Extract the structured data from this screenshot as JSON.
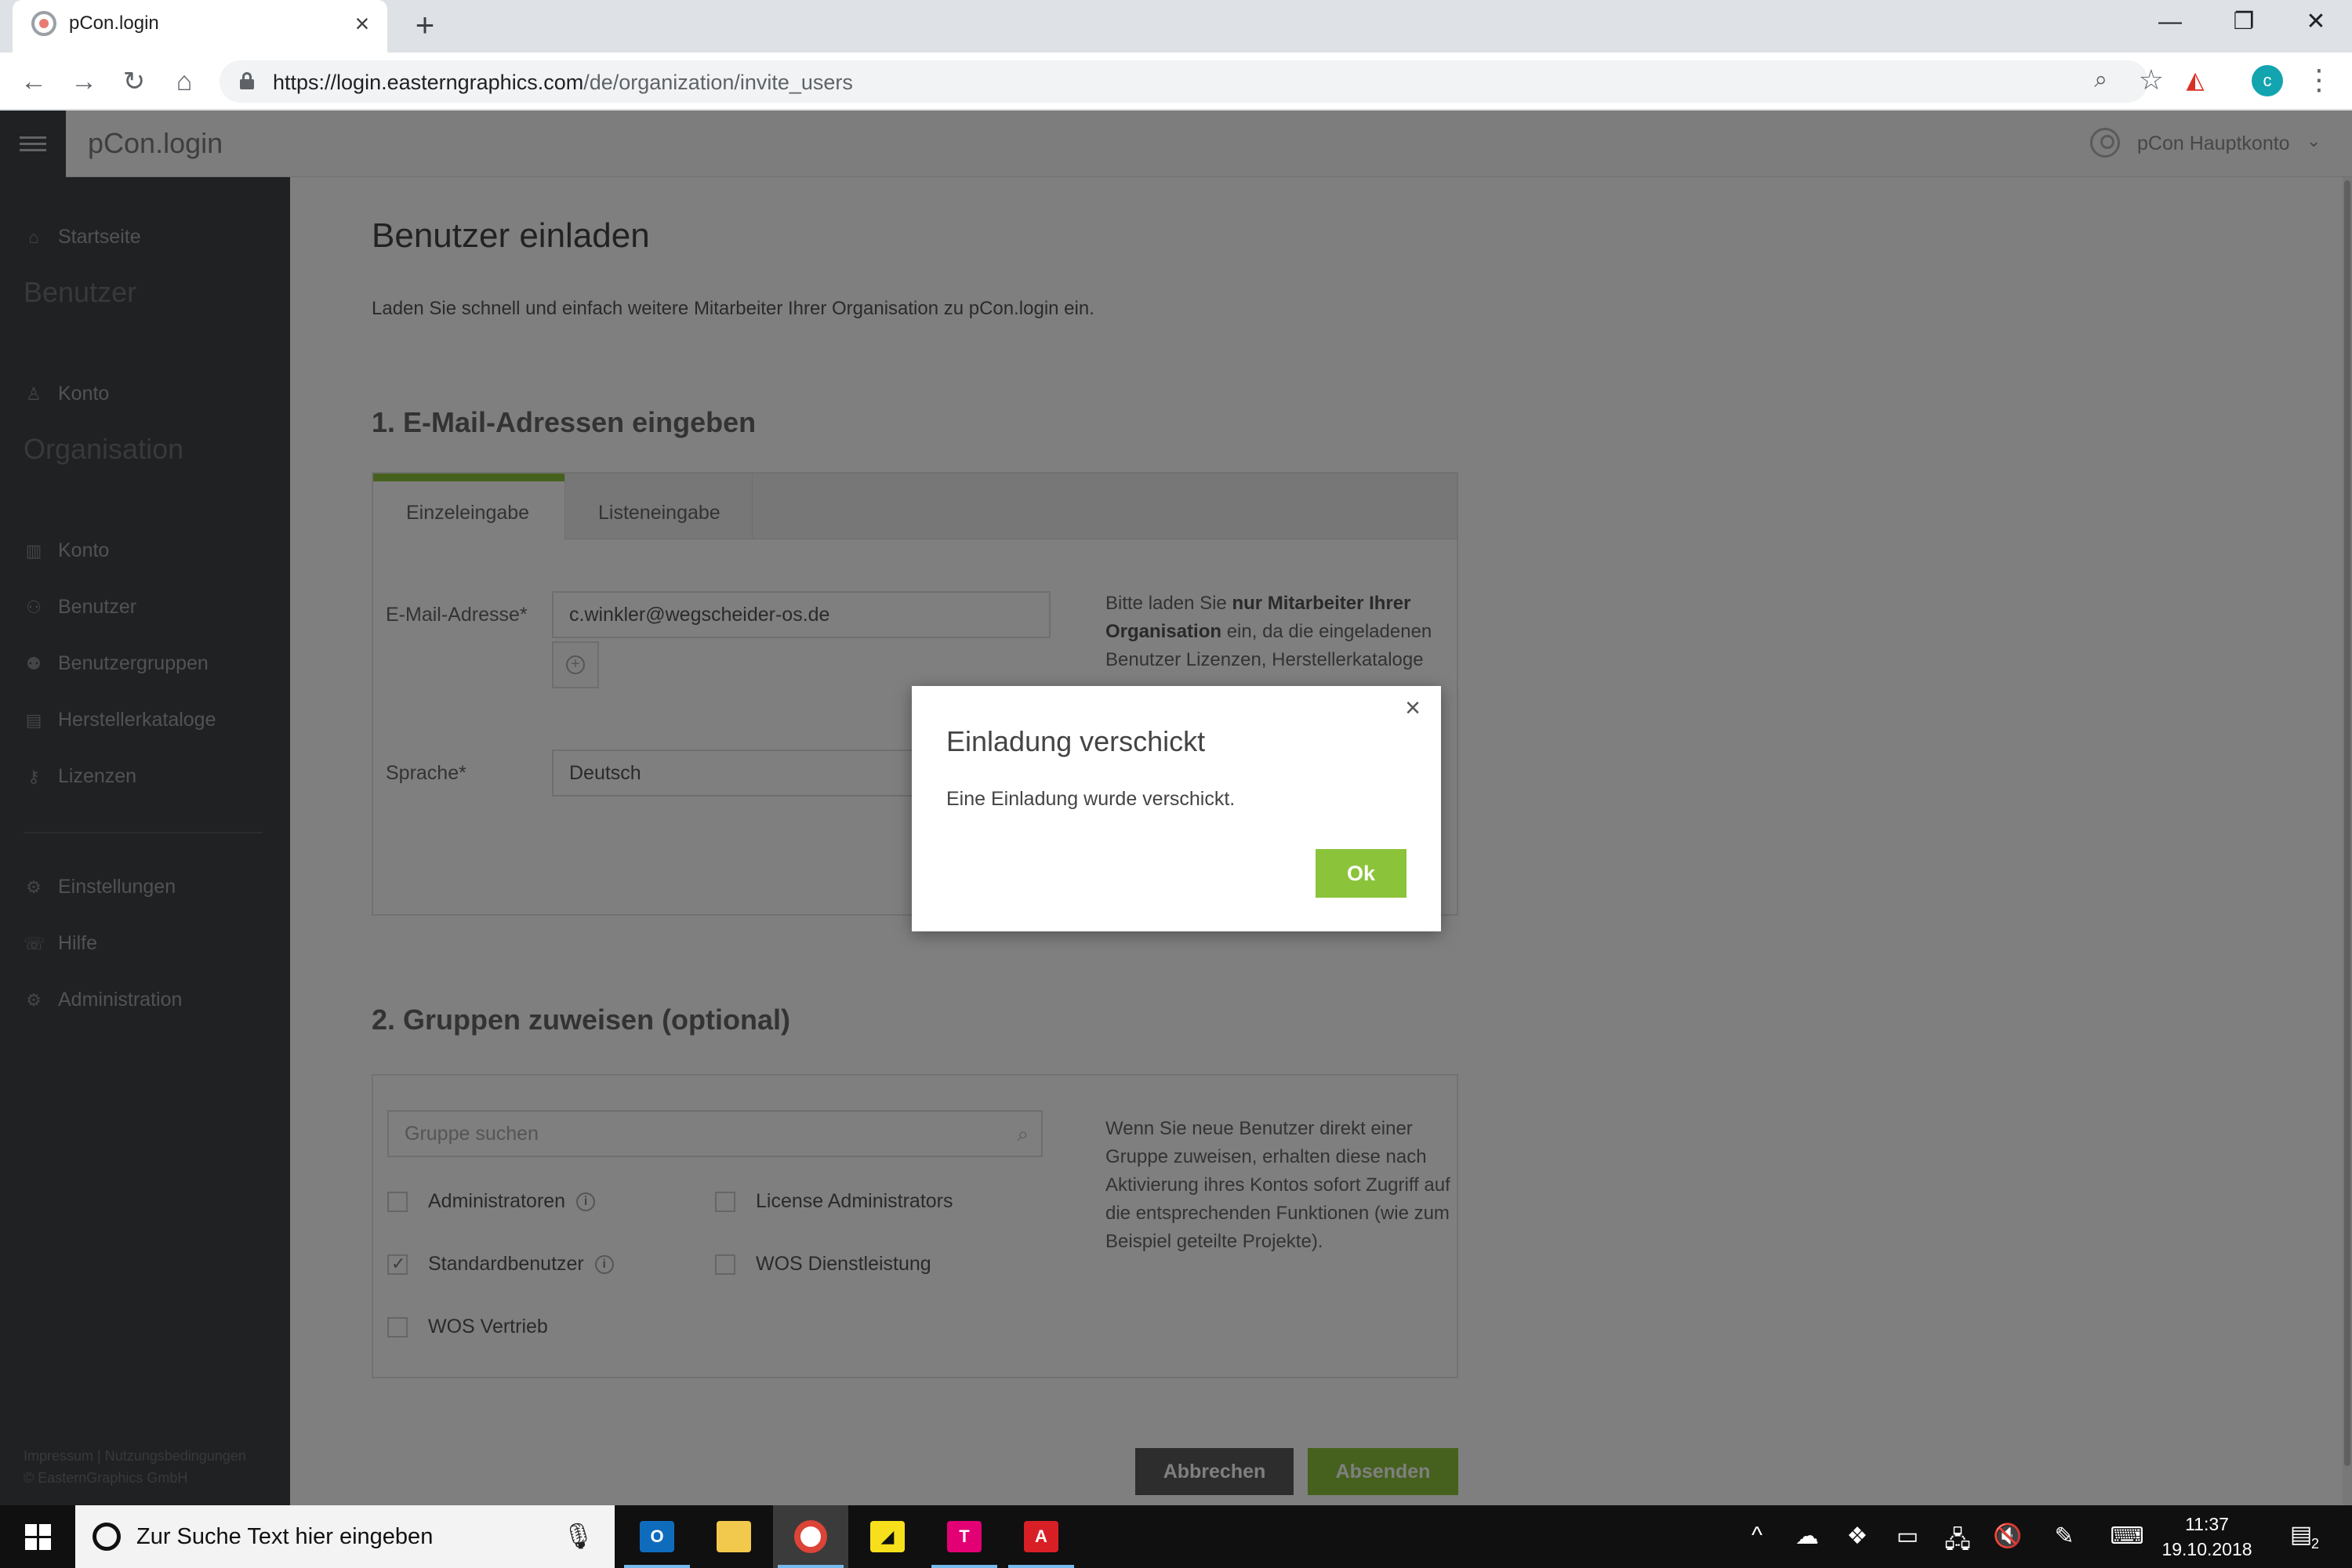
{
  "browser": {
    "tab_title": "pCon.login",
    "url_host": "https://login.easterngraphics.com",
    "url_path": "/de/organization/invite_users",
    "profile_initial": "c"
  },
  "app": {
    "title": "pCon.login",
    "account_name": "pCon Hauptkonto"
  },
  "sidebar": {
    "home": "Startseite",
    "section_user": "Benutzer",
    "user_account": "Konto",
    "section_org": "Organisation",
    "org_items": [
      "Konto",
      "Benutzer",
      "Benutzergruppen",
      "Herstellerkataloge",
      "Lizenzen"
    ],
    "bottom_items": [
      "Einstellungen",
      "Hilfe",
      "Administration"
    ],
    "footer_links": "Impressum | Nutzungsbedingungen",
    "footer_copy": "© EasternGraphics GmbH"
  },
  "main": {
    "title": "Benutzer einladen",
    "lead": "Laden Sie schnell und einfach weitere Mitarbeiter Ihrer Organisation zu pCon.login ein.",
    "step1_title": "1. E-Mail-Adressen eingeben",
    "tabs": [
      "Einzeleingabe",
      "Listeneingabe"
    ],
    "email_label": "E-Mail-Adresse*",
    "email_value": "c.winkler@wegscheider-os.de",
    "language_label": "Sprache*",
    "language_value": "Deutsch",
    "hint1_pre": "Bitte laden Sie ",
    "hint1_bold": "nur Mitarbeiter Ihrer Organisation",
    "hint1_post": " ein, da die eingeladenen Benutzer Lizenzen, Herstellerkataloge",
    "step2_title": "2. Gruppen zuweisen (optional)",
    "group_search_placeholder": "Gruppe suchen",
    "groups": [
      {
        "label": "Administratoren",
        "checked": false,
        "info": true
      },
      {
        "label": "License Administrators",
        "checked": false,
        "info": false
      },
      {
        "label": "Standardbenutzer",
        "checked": true,
        "info": true
      },
      {
        "label": "WOS Dienstleistung",
        "checked": false,
        "info": false
      },
      {
        "label": "WOS Vertrieb",
        "checked": false,
        "info": false
      }
    ],
    "hint2": "Wenn Sie neue Benutzer direkt einer Gruppe zuweisen, erhalten diese nach Aktivierung ihres Kontos sofort Zugriff auf die entsprechenden Funktionen (wie zum Beispiel geteilte Projekte).",
    "cancel_label": "Abbrechen",
    "submit_label": "Absenden"
  },
  "modal": {
    "title": "Einladung verschickt",
    "text": "Eine Einladung wurde verschickt.",
    "ok_label": "Ok"
  },
  "taskbar": {
    "search_text": "Zur Suche Text hier eingeben",
    "time": "11:37",
    "date": "19.10.2018",
    "notification_count": "2"
  },
  "colors": {
    "accent_green": "#8bc33a",
    "sidebar_bg": "#3f4246",
    "cancel_bg": "#5a5a5a"
  }
}
